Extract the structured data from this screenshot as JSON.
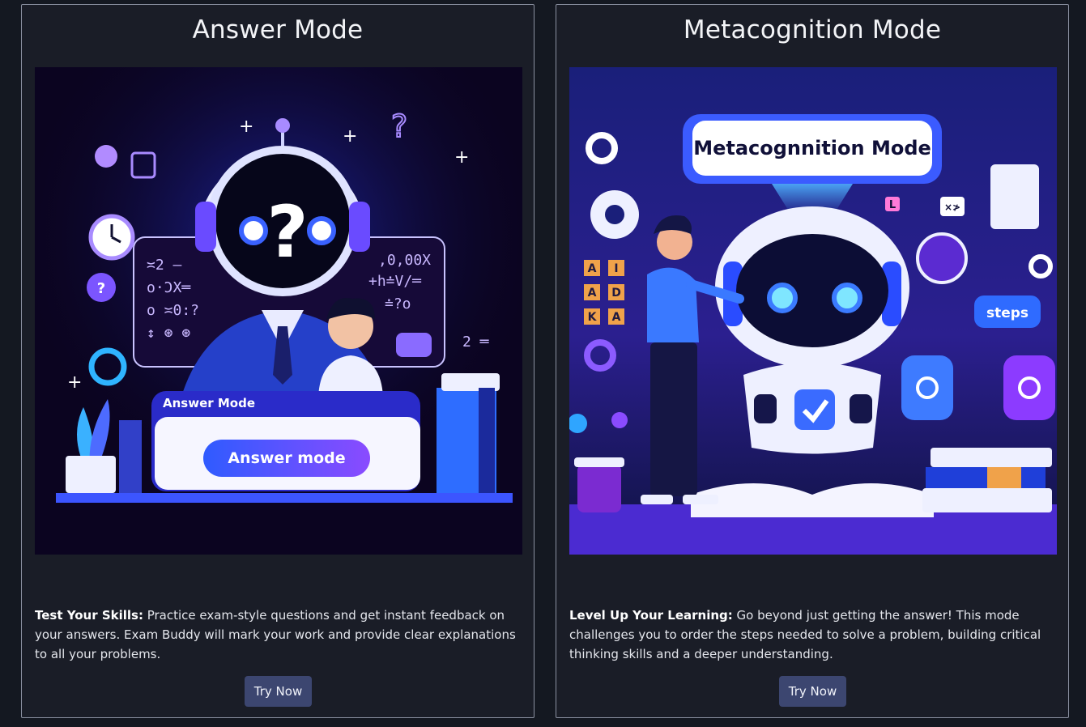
{
  "cards": [
    {
      "title": "Answer Mode",
      "image_texts": {
        "panel_title": "Answer Mode",
        "button": "Answer mode",
        "board_left_1": "≍2 ‒",
        "board_left_2": "o·ƆX═",
        "board_left_3": "o ≍0:?",
        "board_left_4": "↕ ⊛ ⊛",
        "board_right_1": ",0,00X",
        "board_right_2": "+h≐V/═",
        "board_right_3": "≐?o",
        "side_right": "2 ═"
      },
      "description_bold": "Test Your Skills:",
      "description": " Practice exam-style questions and get instant feedback on your answers. Exam Buddy will mark your work and provide clear explanations to all your problems.",
      "button_label": "Try Now"
    },
    {
      "title": "Metacognition Mode",
      "image_texts": {
        "sign": "Metacognnition Mode",
        "steps": "steps",
        "tiles": [
          "A",
          "I",
          "A",
          "D",
          "K",
          "A"
        ],
        "small_l": "L",
        "x_tile": "×≯"
      },
      "description_bold": "Level Up Your Learning:",
      "description": " Go beyond just getting the answer! This mode challenges you to order the steps needed to solve a problem, building critical thinking skills and a deeper understanding.",
      "button_label": "Try Now"
    }
  ],
  "colors": {
    "page_bg": "#141821",
    "card_bg": "#1a1d27",
    "card_border": "#8a90a0",
    "button_bg": "#3c4670",
    "accent_blue": "#2f5bff",
    "accent_purple": "#8a4bff"
  }
}
